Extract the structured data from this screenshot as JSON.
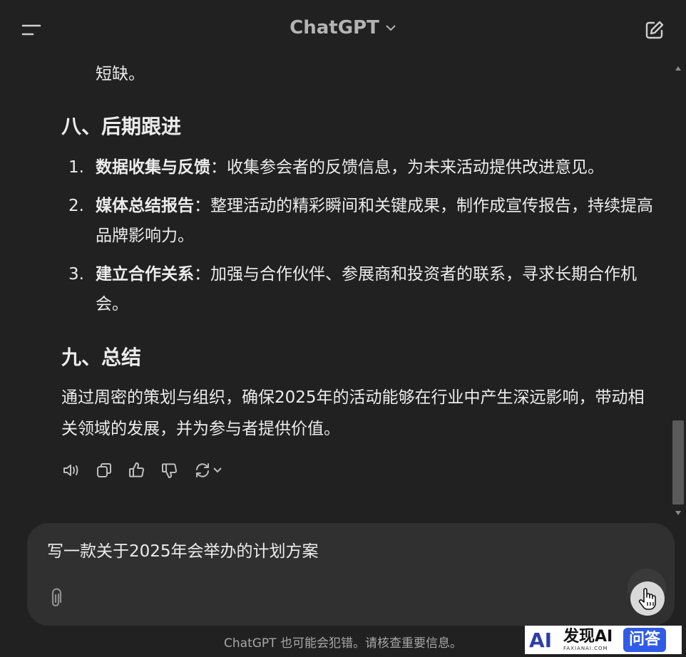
{
  "header": {
    "title": "ChatGPT"
  },
  "content": {
    "continuation": "短缺。",
    "section8": {
      "heading": "八、后期跟进",
      "items": [
        {
          "num": "1.",
          "bold": "数据收集与反馈",
          "text": "：收集参会者的反馈信息，为未来活动提供改进意见。"
        },
        {
          "num": "2.",
          "bold": "媒体总结报告",
          "text": "：整理活动的精彩瞬间和关键成果，制作成宣传报告，持续提高品牌影响力。"
        },
        {
          "num": "3.",
          "bold": "建立合作关系",
          "text": "：加强与合作伙伴、参展商和投资者的联系，寻求长期合作机会。"
        }
      ]
    },
    "section9": {
      "heading": "九、总结",
      "paragraph": "通过周密的策划与组织，确保2025年的活动能够在行业中产生深远影响，带动相关领域的发展，并为参与者提供价值。"
    }
  },
  "actions": {
    "icons": [
      "speaker-icon",
      "copy-icon",
      "thumbs-up-icon",
      "thumbs-down-icon",
      "regenerate-icon"
    ]
  },
  "composer": {
    "value": "写一款关于2025年会举办的计划方案"
  },
  "footer": {
    "note": "ChatGPT 也可能会犯错。请核查重要信息。"
  },
  "watermark": {
    "logo": "AI",
    "main": "发现AI",
    "sub": "FAXIANAI.COM",
    "badge": "问答"
  },
  "colors": {
    "background": "#212121",
    "composer": "#303030",
    "text": "#ececec",
    "muted": "#a8a8a8"
  }
}
